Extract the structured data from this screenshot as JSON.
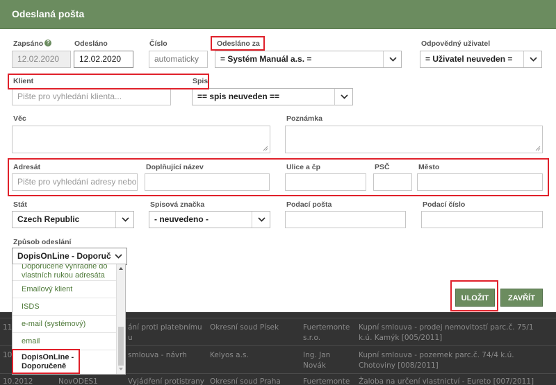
{
  "dialog": {
    "title": "Odeslaná pošta"
  },
  "fields": {
    "zapsano": {
      "label": "Zapsáno",
      "value": "12.02.2020"
    },
    "odeslano": {
      "label": "Odesláno",
      "value": "12.02.2020"
    },
    "cislo": {
      "label": "Číslo",
      "value": "automaticky"
    },
    "odeslano_za": {
      "label": "Odesláno za",
      "value": "= Systém Manuál a.s. ="
    },
    "odpovedny": {
      "label": "Odpovědný uživatel",
      "value": "= Uživatel neuveden ="
    },
    "klient": {
      "label": "Klient",
      "placeholder": "Pište pro vyhledání klienta..."
    },
    "spis": {
      "label": "Spis",
      "value": "== spis neuveden =="
    },
    "vec": {
      "label": "Věc"
    },
    "poznamka": {
      "label": "Poznámka"
    },
    "adresat": {
      "label": "Adresát",
      "placeholder": "Pište pro vyhledání adresy nebo"
    },
    "doplnujici": {
      "label": "Doplňující název"
    },
    "ulice": {
      "label": "Ulice a čp"
    },
    "psc": {
      "label": "PSČ"
    },
    "mesto": {
      "label": "Město"
    },
    "stat": {
      "label": "Stát",
      "value": "Czech Republic"
    },
    "spisova": {
      "label": "Spisová značka",
      "value": "- neuvedeno -"
    },
    "podaci_posta": {
      "label": "Podací pošta"
    },
    "podaci_cislo": {
      "label": "Podací číslo"
    },
    "zpusob": {
      "label": "Způsob odeslání",
      "value": "DopisOnLine - Doporuč"
    }
  },
  "dropdown": {
    "items": [
      {
        "label": "Doporučeně vyhradne do vlastních rukou adresáta"
      },
      {
        "label": "Emailový klient"
      },
      {
        "label": "ISDS"
      },
      {
        "label": "e-mail (systémový)"
      },
      {
        "label": "email"
      },
      {
        "label": "DopisOnLine - Doporučeně"
      }
    ]
  },
  "buttons": {
    "save": "ULOŽIT",
    "close": "ZAVŘÍT"
  },
  "background_rows": [
    {
      "c1": "11",
      "c2": "ání proti platebnímu",
      "c2b": "u",
      "c3": "Okresní soud Písek",
      "c4": "Fuertemonte",
      "c4b": "s.r.o.",
      "c5": "Kupní smlouva - prodej nemovitostí parc.č. 75/1",
      "c5b": "k.ú. Kamýk [005/2011]"
    },
    {
      "c1": "10",
      "c2": "smlouva - návrh",
      "c3": "Kelyos a.s.",
      "c4": "Ing. Jan",
      "c4b": "Novák",
      "c5": "Kupní smlouva - pozemek parc.č. 74/4 k.ú.",
      "c5b": "Chotoviny [008/2011]"
    },
    {
      "c1": "10.2012",
      "c2": "NovODES1",
      "c3": "Vyjádření protistrany",
      "c4": "Okresní soud Praha",
      "c5": "Fuertemonte",
      "c6": "Žaloba na určení vlastnictví - Eureto [007/2011]"
    }
  ],
  "colors": {
    "header": "#6b8c5f",
    "accent_green": "#4f7a3a",
    "highlight": "#e0202a"
  }
}
